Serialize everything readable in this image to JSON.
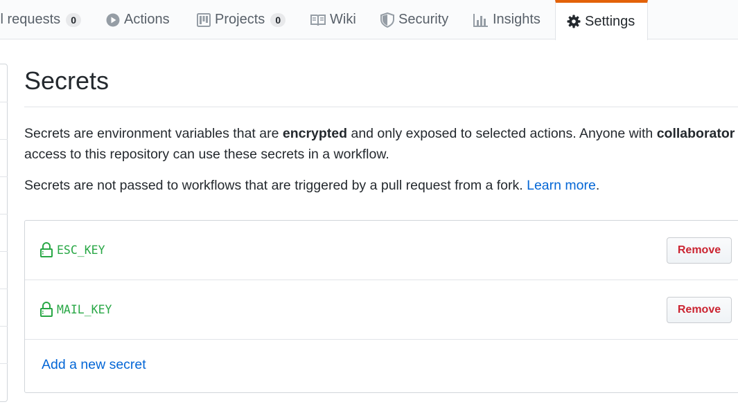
{
  "tabs": [
    {
      "label": "ll requests",
      "count": "0",
      "icon": "pull-request-icon"
    },
    {
      "label": "Actions",
      "icon": "play-icon"
    },
    {
      "label": "Projects",
      "count": "0",
      "icon": "project-icon"
    },
    {
      "label": "Wiki",
      "icon": "book-icon"
    },
    {
      "label": "Security",
      "icon": "shield-icon"
    },
    {
      "label": "Insights",
      "icon": "graph-icon"
    },
    {
      "label": "Settings",
      "icon": "gear-icon",
      "selected": true
    }
  ],
  "page": {
    "title": "Secrets",
    "intro": {
      "p1_part1": "Secrets are environment variables that are ",
      "p1_bold1": "encrypted",
      "p1_part2": " and only exposed to selected actions. Anyone with ",
      "p1_bold2": "collaborator",
      "p1_line2": "access to this repository can use these secrets in a workflow.",
      "p2_text": "Secrets are not passed to workflows that are triggered by a pull request from a fork. ",
      "p2_link": "Learn more",
      "p2_end": "."
    }
  },
  "secrets": [
    {
      "name": "ESC_KEY",
      "remove_label": "Remove"
    },
    {
      "name": "MAIL_KEY",
      "remove_label": "Remove"
    }
  ],
  "add_secret_label": "Add a new secret",
  "colors": {
    "accent": "#e36209",
    "link": "#0366d6",
    "secret_name": "#28a745",
    "danger": "#cb2431"
  }
}
